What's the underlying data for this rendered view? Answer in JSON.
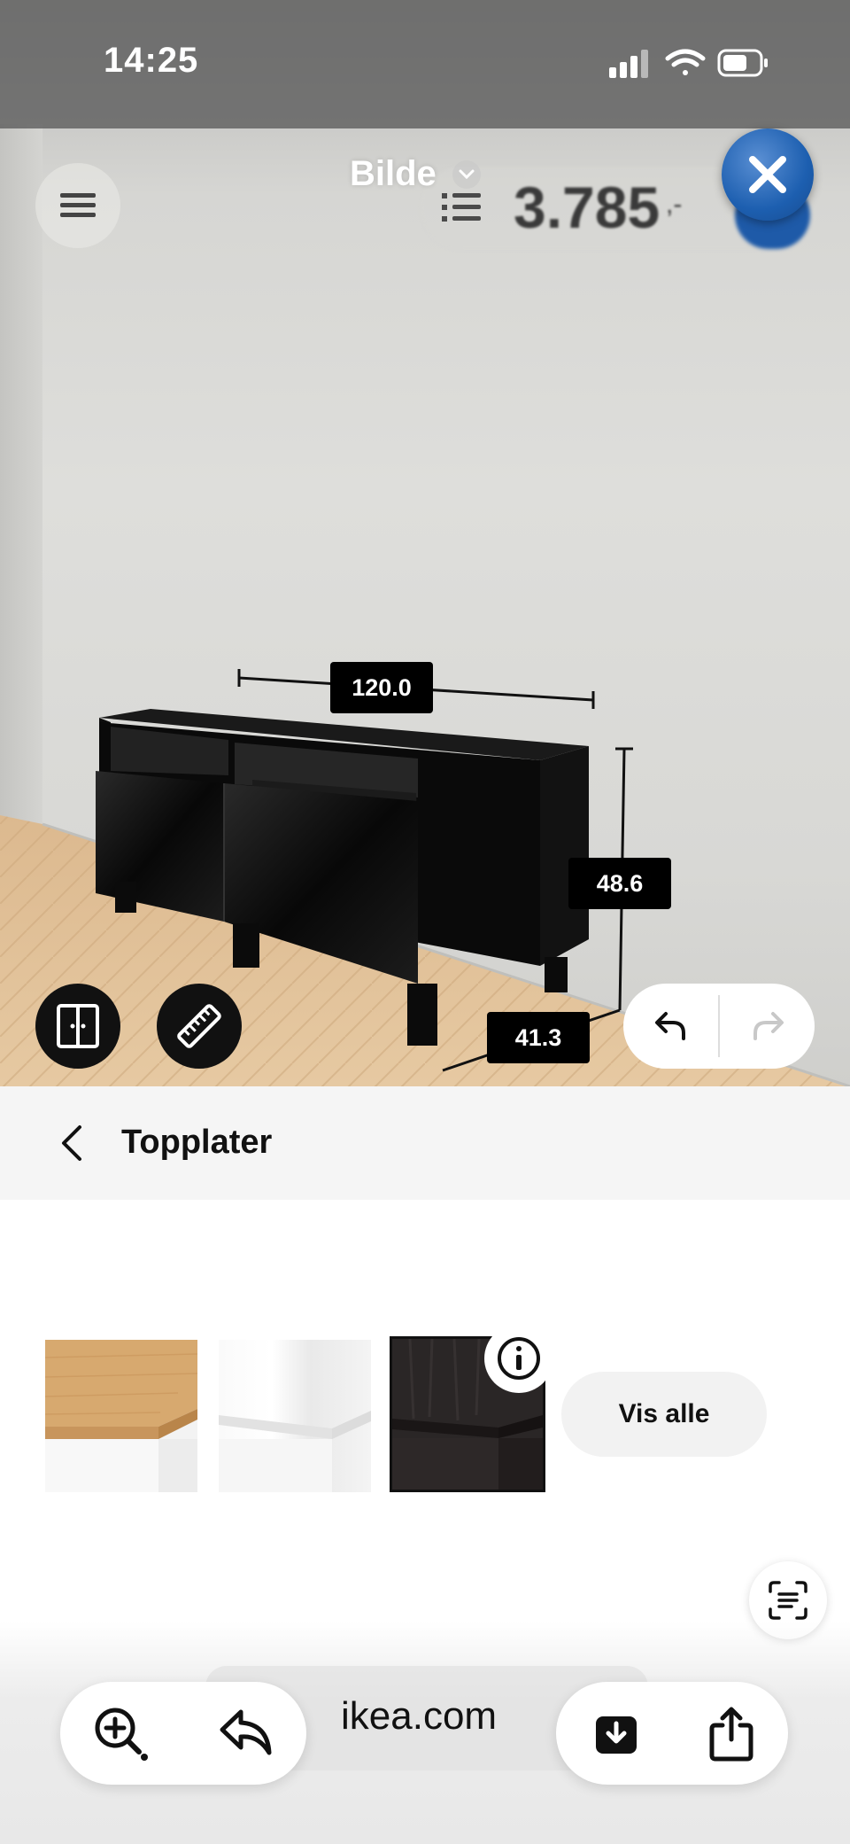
{
  "status_bar": {
    "time": "14:25"
  },
  "header": {
    "title": "Bilde",
    "price": "3.785",
    "price_suffix": ",-"
  },
  "dimensions": {
    "width": "120.0",
    "height": "48.6",
    "depth": "41.3"
  },
  "panel": {
    "title": "Topplater",
    "show_all_label": "Vis alle"
  },
  "swatches": [
    {
      "name": "oak-top"
    },
    {
      "name": "white-top"
    },
    {
      "name": "black-brown-top",
      "selected": true
    }
  ],
  "browser": {
    "url": "ikea.com"
  },
  "colors": {
    "accent_blue": "#1d5fb0",
    "label_bg": "#000000"
  }
}
